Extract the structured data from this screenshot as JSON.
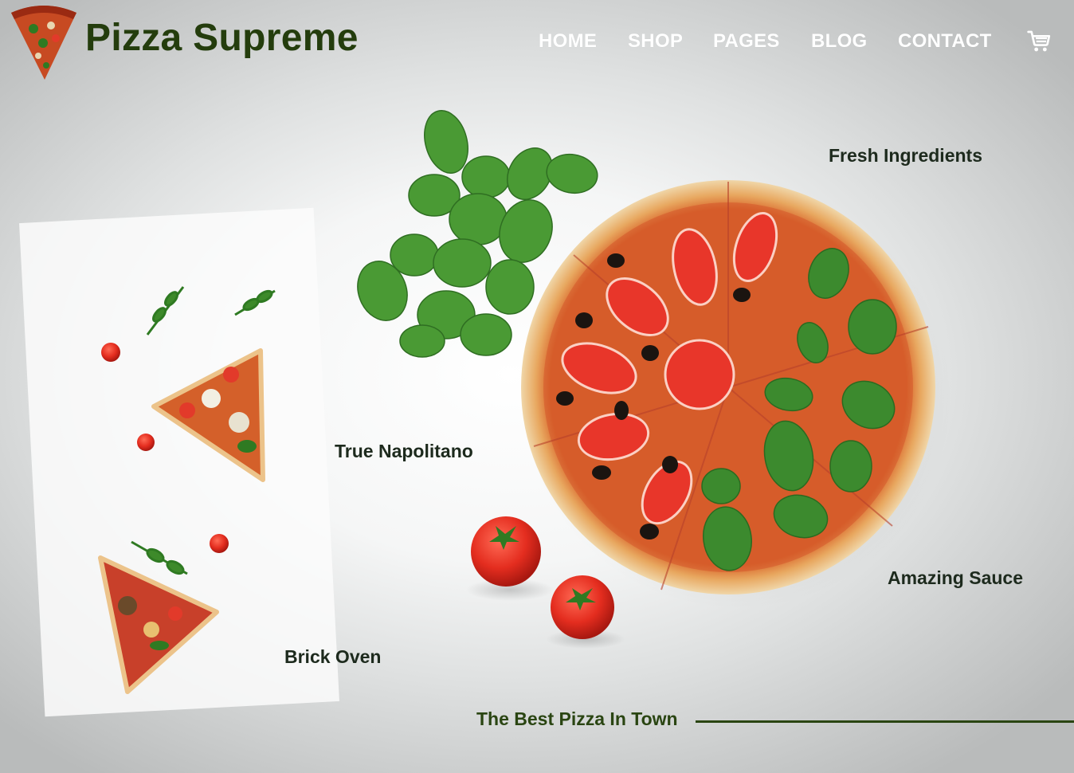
{
  "brand": {
    "name": "Pizza Supreme",
    "logo_icon": "pizza-slice-icon"
  },
  "nav": {
    "items": [
      {
        "label": "HOME"
      },
      {
        "label": "SHOP"
      },
      {
        "label": "PAGES"
      },
      {
        "label": "BLOG"
      },
      {
        "label": "CONTACT"
      }
    ],
    "cart_icon": "shopping-cart-icon"
  },
  "features": {
    "fresh": "Fresh Ingredients",
    "napolitano": "True Napolitano",
    "sauce": "Amazing Sauce",
    "oven": "Brick Oven"
  },
  "tagline": "The Best Pizza In Town",
  "colors": {
    "brand_green": "#243d0d",
    "nav_text": "#ffffff",
    "label_text": "#1d2a1d",
    "tagline": "#2a4512"
  }
}
